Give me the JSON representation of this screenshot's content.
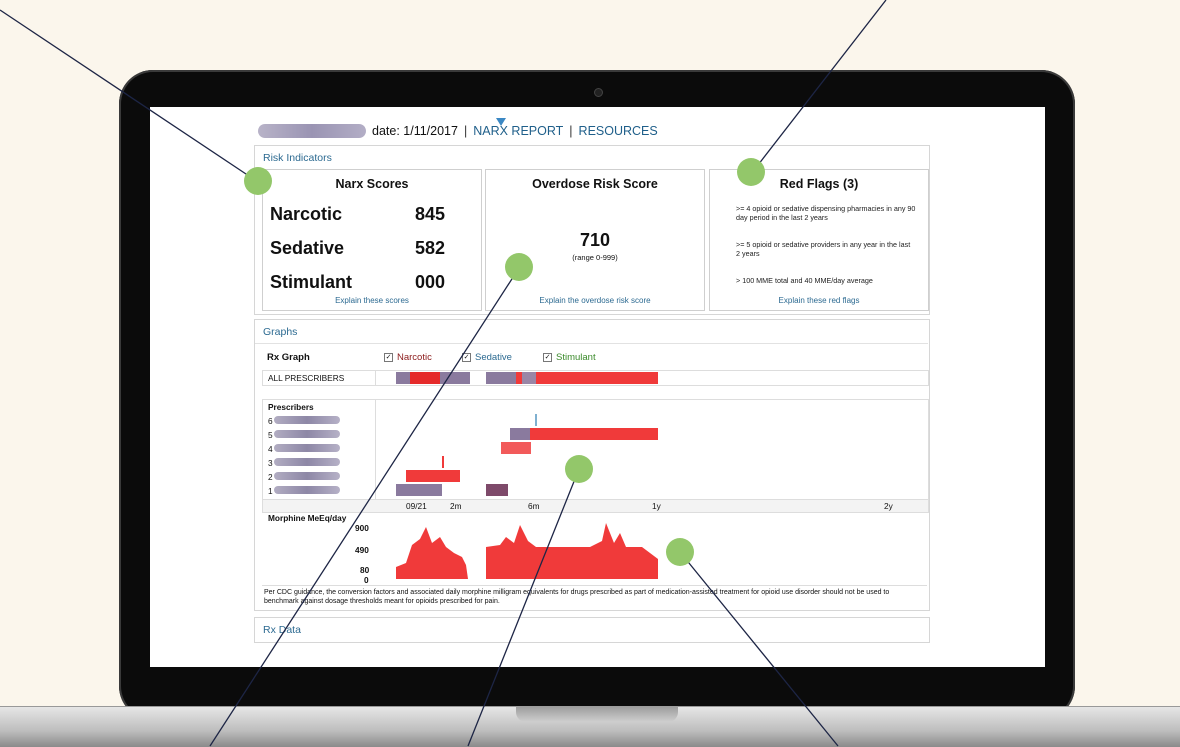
{
  "topbar": {
    "date_label": "date: 1/11/2017",
    "sep": "|",
    "narx_report": "NARX REPORT",
    "resources": "RESOURCES"
  },
  "risk_indicators": {
    "title": "Risk Indicators",
    "narx_scores": {
      "heading": "Narx Scores",
      "rows": [
        {
          "label": "Narcotic",
          "value": "845"
        },
        {
          "label": "Sedative",
          "value": "582"
        },
        {
          "label": "Stimulant",
          "value": "000"
        }
      ],
      "explain": "Explain these scores"
    },
    "overdose": {
      "heading": "Overdose Risk Score",
      "value": "710",
      "range": "(range 0-999)",
      "explain": "Explain the overdose risk score"
    },
    "red_flags": {
      "heading": "Red Flags (3)",
      "items": [
        ">= 4 opioid or sedative dispensing pharmacies in any 90 day period in the last 2 years",
        ">= 5 opioid or sedative providers in any year in the last 2 years",
        "> 100 MME total and 40 MME/day average"
      ],
      "explain": "Explain these red flags"
    }
  },
  "graphs": {
    "title": "Graphs",
    "rx_graph_label": "Rx Graph",
    "toggles": [
      {
        "label": "Narcotic",
        "checked": true,
        "color": "#8b1a1a"
      },
      {
        "label": "Sedative",
        "checked": true,
        "color": "#2c6a91"
      },
      {
        "label": "Stimulant",
        "checked": true,
        "color": "#3a8a2a"
      }
    ],
    "all_prescribers": "ALL PRESCRIBERS",
    "prescribers_label": "Prescribers",
    "prescriber_ids": [
      "6",
      "5",
      "4",
      "3",
      "2",
      "1"
    ],
    "time_ticks": [
      "09/21",
      "2m",
      "6m",
      "1y",
      "2y"
    ],
    "morphine_label": "Morphine MeEq/day",
    "morphine_ticks": [
      "900",
      "490",
      "80",
      "0"
    ],
    "note": "Per CDC guidance, the conversion factors and associated daily morphine milligram equivalents for drugs prescribed as part of medication-assisted treatment for opioid use disorder should not be used to benchmark against dosage thresholds meant for opioids prescribed for pain."
  },
  "rx_data": {
    "title": "Rx Data"
  },
  "colors": {
    "accent": "#2c6a91",
    "callout": "#93c76a",
    "bar_red": "#f03a3a",
    "bar_purple": "#8a7a9e"
  }
}
